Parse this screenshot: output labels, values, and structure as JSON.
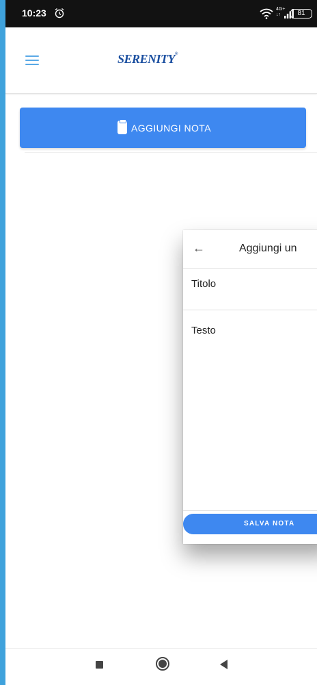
{
  "status_bar": {
    "time": "10:23",
    "network_type": "4G+",
    "network_sub": "↓↑",
    "battery_level": "81"
  },
  "header": {
    "brand": "SERENITY",
    "brand_mark": "®"
  },
  "notes_page": {
    "add_note_label": "AGGIUNGI NOTA"
  },
  "dialog": {
    "title": "Aggiungi un",
    "title_field_label": "Titolo",
    "text_field_label": "Testo",
    "save_label": "SALVA NOTA"
  },
  "colors": {
    "accent": "#3e88f0",
    "brand": "#1b4fa0",
    "frame": "#3fa2dc"
  }
}
